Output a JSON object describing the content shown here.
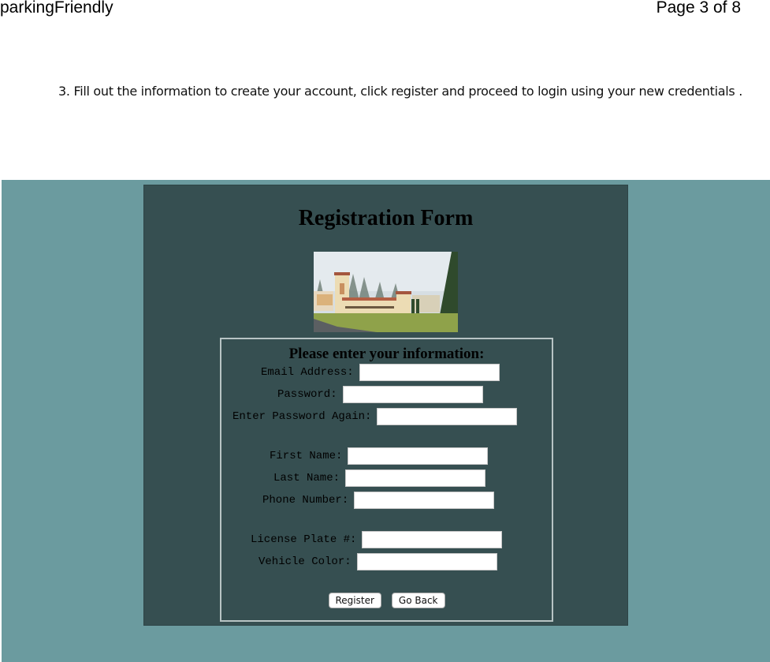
{
  "page_header": {
    "app_name": "parkingFriendly",
    "page_indicator": "Page 3 of 8"
  },
  "instruction": "3. Fill out the information to create your account, click register and proceed to login using your new credentials .",
  "screenshot": {
    "form_title": "Registration Form",
    "image_alt": "Campus building with Humboldt State University sign",
    "form_heading": "Please enter your information:",
    "fields": [
      {
        "label": "Email Address:",
        "value": ""
      },
      {
        "label": "Password:",
        "value": ""
      },
      {
        "label": "Enter Password Again:",
        "value": ""
      },
      {
        "label": "First Name:",
        "value": ""
      },
      {
        "label": "Last Name:",
        "value": ""
      },
      {
        "label": "Phone Number:",
        "value": ""
      },
      {
        "label": "License Plate #:",
        "value": ""
      },
      {
        "label": "Vehicle Color:",
        "value": ""
      }
    ],
    "buttons": {
      "register": "Register",
      "go_back": "Go Back"
    },
    "colors": {
      "outer_bg": "#6b9b9f",
      "panel_bg": "#364f51"
    }
  }
}
